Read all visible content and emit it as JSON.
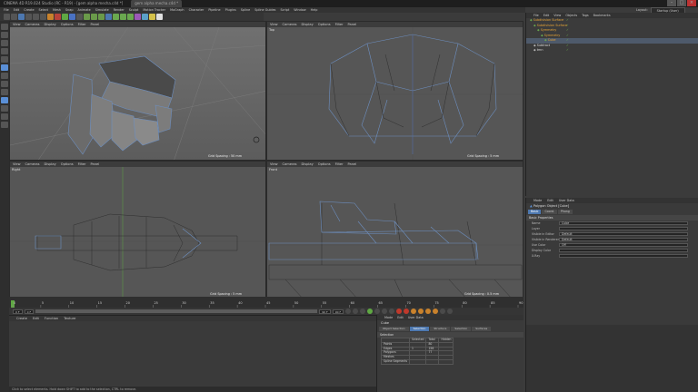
{
  "window": {
    "title": "CINEMA 4D R19.024 Studio (RC - R19) - [gem alpha mecha.c4d *]",
    "tab": "gem alpha mecha.c4d *",
    "layout_label": "Layout:",
    "layout_value": "Startup (User)"
  },
  "menu": [
    "File",
    "Edit",
    "Create",
    "Select",
    "Mesh",
    "Snap",
    "Animate",
    "Simulate",
    "Render",
    "Sculpt",
    "Motion Tracker",
    "MoGraph",
    "Character",
    "Pipeline",
    "Plugins",
    "Spline",
    "Spline Guides",
    "Script",
    "Window",
    "Help"
  ],
  "viewport_menu": [
    "View",
    "Cameras",
    "Display",
    "Options",
    "Filter",
    "Panel"
  ],
  "viewports": [
    {
      "name": "Perspective",
      "grid": "Grid Spacing : 50 mm"
    },
    {
      "name": "Top",
      "grid": "Grid Spacing : 5 mm"
    },
    {
      "name": "Right",
      "grid": "Grid Spacing : 5 mm"
    },
    {
      "name": "Front",
      "grid": "Grid Spacing : 0.5 mm"
    }
  ],
  "timeline": {
    "start": "0 F",
    "end": "90 F",
    "current": "0 F",
    "ticks": [
      "0",
      "5",
      "10",
      "15",
      "20",
      "25",
      "30",
      "35",
      "40",
      "45",
      "50",
      "55",
      "60",
      "65",
      "70",
      "75",
      "80",
      "85",
      "90"
    ]
  },
  "material_menu": [
    "Create",
    "Edit",
    "Function",
    "Texture"
  ],
  "status": "Click to select elements. Hold down SHIFT to add to the selection, CTRL to remove.",
  "object_manager": {
    "menu": [
      "File",
      "Edit",
      "View",
      "Objects",
      "Tags",
      "Bookmarks"
    ],
    "objects": [
      {
        "name": "Subdivision Surface",
        "white": false,
        "selected": false
      },
      {
        "name": "Subdivision Surface",
        "white": false,
        "selected": false
      },
      {
        "name": "Symmetry",
        "white": false,
        "selected": false
      },
      {
        "name": "Symmetry",
        "white": false,
        "selected": false
      },
      {
        "name": "Cube",
        "white": false,
        "selected": true
      },
      {
        "name": "Subtract",
        "white": true,
        "selected": false
      },
      {
        "name": "tmn",
        "white": true,
        "selected": false
      }
    ]
  },
  "attributes": {
    "menu": [
      "Mode",
      "Edit",
      "User Data"
    ],
    "object_title": "Polygon Object [Cube]",
    "tabs": [
      "Basic",
      "Coord.",
      "Phong"
    ],
    "section": "Basic Properties",
    "props": [
      {
        "label": "Name",
        "value": "Cube"
      },
      {
        "label": "Layer",
        "value": ""
      },
      {
        "label": "Visible in Editor",
        "value": "Default"
      },
      {
        "label": "Visible in Renderer",
        "value": "Default"
      },
      {
        "label": "Use Color",
        "value": "Off"
      },
      {
        "label": "Display Color",
        "value": ""
      },
      {
        "label": "X-Ray",
        "value": ""
      }
    ]
  },
  "structure": {
    "menu": [
      "Mode",
      "Edit",
      "User Data"
    ],
    "title": "Cube",
    "tabs": [
      "Object Selection",
      "Selection",
      "Structure",
      "Selection",
      "Surfaces"
    ],
    "section": "Selection",
    "columns": [
      "",
      "Selected",
      "Total",
      "Hidden"
    ],
    "rows": [
      {
        "label": "Points",
        "selected": "",
        "total": "80",
        "hidden": ""
      },
      {
        "label": "Edges",
        "selected": "1",
        "total": "156",
        "hidden": ""
      },
      {
        "label": "Polygons",
        "selected": "",
        "total": "77",
        "hidden": ""
      },
      {
        "label": "Meshes",
        "selected": "",
        "total": "",
        "hidden": ""
      },
      {
        "label": "Spline Segments",
        "selected": "",
        "total": "",
        "hidden": ""
      }
    ]
  }
}
